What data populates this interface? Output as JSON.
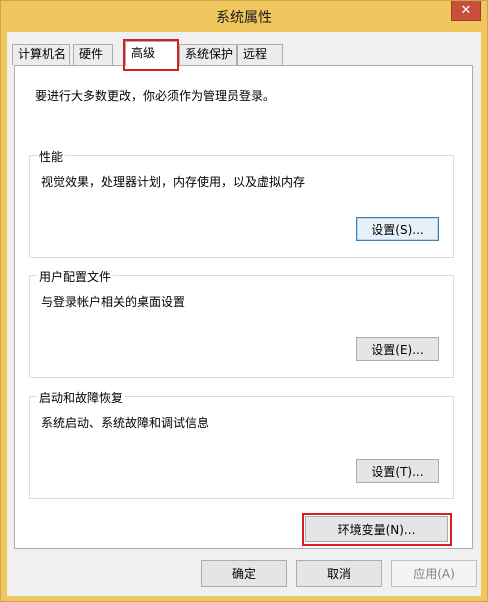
{
  "window": {
    "title": "系统属性",
    "close_glyph": "✕"
  },
  "tabs": [
    {
      "label": "计算机名"
    },
    {
      "label": "硬件"
    },
    {
      "label": "高级",
      "active": true
    },
    {
      "label": "系统保护"
    },
    {
      "label": "远程"
    }
  ],
  "advanced": {
    "admin_note": "要进行大多数更改，你必须作为管理员登录。",
    "performance": {
      "title": "性能",
      "description": "视觉效果，处理器计划，内存使用，以及虚拟内存",
      "button": "设置(S)..."
    },
    "user_profiles": {
      "title": "用户配置文件",
      "description": "与登录帐户相关的桌面设置",
      "button": "设置(E)..."
    },
    "startup_recovery": {
      "title": "启动和故障恢复",
      "description": "系统启动、系统故障和调试信息",
      "button": "设置(T)..."
    },
    "env_button": "环境变量(N)..."
  },
  "footer": {
    "ok": "确定",
    "cancel": "取消",
    "apply": "应用(A)"
  },
  "colors": {
    "frame": "#f0c75e",
    "close": "#c7503c",
    "highlight": "#d82020"
  }
}
